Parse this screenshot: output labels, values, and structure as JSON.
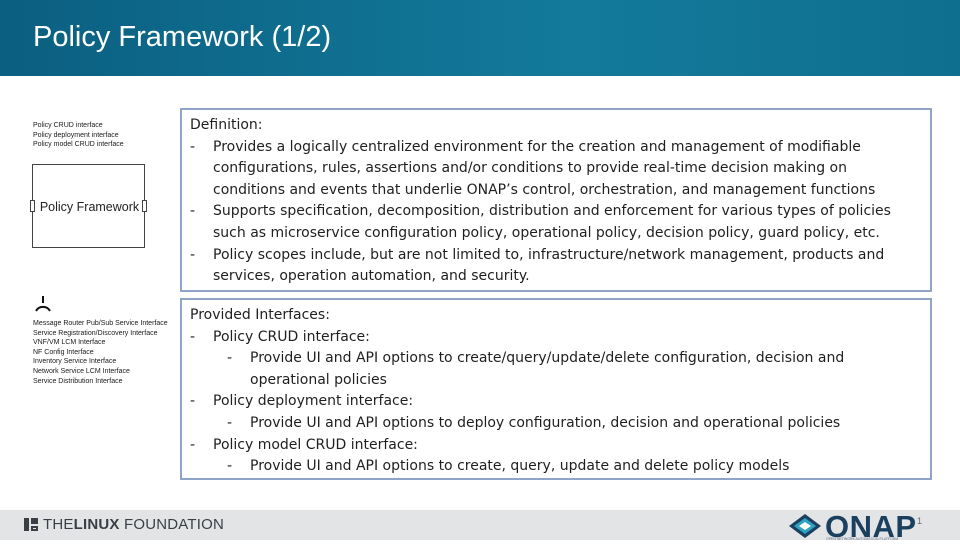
{
  "slide": {
    "title": "Policy Framework (1/2)",
    "page_number": "1"
  },
  "diagram": {
    "top_interfaces": [
      "Policy CRUD interface",
      "Policy deployment interface",
      "Policy model CRUD interface"
    ],
    "component_label": "Policy Framework",
    "bottom_interfaces": [
      "Message Router Pub/Sub Service Interface",
      "Service Registration/Discovery Interface",
      "VNF/VM LCM Interface",
      "NF Config Interface",
      "Inventory Service Interface",
      "Network Service LCM Interface",
      "Service Distribution Interface"
    ]
  },
  "definition": {
    "heading": "Definition:",
    "bullets": [
      "Provides a logically centralized environment for the creation and management of modifiable configurations, rules, assertions and/or conditions to provide real-time decision making on conditions and events that underlie ONAP’s control, orchestration, and management functions",
      "Supports specification, decomposition, distribution and enforcement for various types of policies such as microservice configuration policy, operational policy, decision policy, guard policy, etc.",
      "Policy scopes include, but are not limited to, infrastructure/network management, products and services, operation automation, and security."
    ]
  },
  "provided_interfaces": {
    "heading": "Provided Interfaces:",
    "items": [
      {
        "label": "Policy CRUD interface:",
        "sub": "Provide UI and API options to create/query/update/delete configuration, decision and operational policies"
      },
      {
        "label": "Policy deployment interface:",
        "sub": "Provide UI and API options to deploy configuration, decision and operational policies"
      },
      {
        "label": "Policy model CRUD interface:",
        "sub": "Provide UI and API options to create, query, update and delete policy models"
      }
    ]
  },
  "footer": {
    "linux_foundation_prefix": "THE",
    "linux_foundation_bold": "LINUX",
    "linux_foundation_suffix": "FOUNDATION",
    "onap_logo_text": "ONAP",
    "onap_tagline": "OPEN NETWORK AUTOMATION PLATFORM"
  },
  "colors": {
    "header": "#137a9c",
    "box_border": "#90a4c8",
    "footer": "#e3e4e6",
    "onap_blue": "#1b3f5e"
  }
}
